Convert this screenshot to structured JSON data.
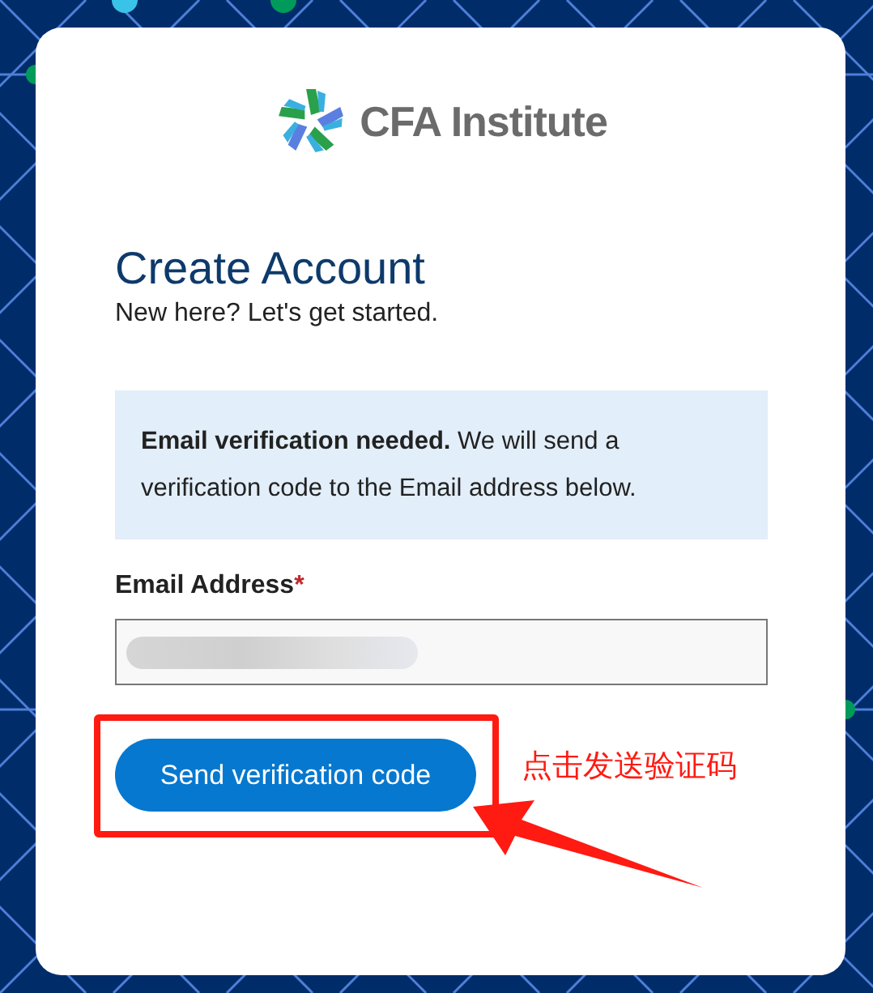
{
  "logo": {
    "text": "CFA Institute"
  },
  "heading": "Create Account",
  "subheading": "New here? Let's get started.",
  "notice": "**Email verification needed.** We will send a verification code to the Email address below.",
  "email_field": {
    "label": "Email Address",
    "required_mark": "*"
  },
  "button": "Send verification code",
  "annotation": {
    "text": "点击发送验证码"
  }
}
